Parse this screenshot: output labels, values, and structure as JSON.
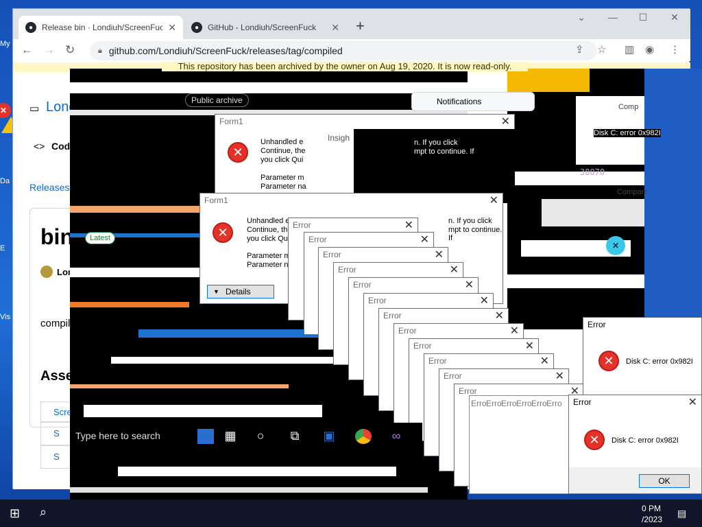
{
  "browser": {
    "tabs": [
      {
        "label": "Release bin · Londiuh/ScreenFuck",
        "active": true
      },
      {
        "label": "GitHub - Londiuh/ScreenFuck",
        "active": false
      }
    ],
    "new_tab_label": "+",
    "url": "github.com/Londiuh/ScreenFuck/releases/tag/compiled",
    "archive_banner": "This repository has been archived by the owner on Aug 19, 2020. It is now read-only."
  },
  "github": {
    "repo_owner": "Lond",
    "code_tab": "Code",
    "releases_link": "Releases",
    "release_title": "bin",
    "author": "Lond",
    "release_body": "compiled exe",
    "assets_heading": "Assets",
    "assets": [
      "ScreenFuck",
      "S",
      "S"
    ],
    "notifications": "Notifications",
    "public_archive": "Public archive",
    "latest_badge": "Latest"
  },
  "form_dialogs": [
    {
      "title": "Form1",
      "message": "Unhandled exception has occurred in your application. If you click Continue, the application will ignore this error and attempt to continue. If you click Quit, the application will close immediately.",
      "line1": "Unhandled e",
      "line1b": "n. If you click",
      "line2": "Continue, the",
      "line2b": "mpt to continue. If",
      "line3": "you click Qui",
      "detail1": "Parameter m",
      "detail2": "Parameter na"
    },
    {
      "title": "Form1",
      "line1": "Unhandled e",
      "line1b": "n. If you click",
      "line2": "Continue, the",
      "line2b": "mpt to continue. If",
      "line3": "you click Qui",
      "detail1": "Parameter m",
      "detail2": "Parameter na",
      "details_button": "Details"
    }
  ],
  "error_dialogs": {
    "title": "Error",
    "message": "Disk C: error 0x982I",
    "ok_label": "OK",
    "tab_fragments": [
      "Erro",
      "Erro",
      "Erro",
      "Erro",
      "Erro",
      "Erro",
      "Erro"
    ],
    "compare_fragment": "Compare",
    "comp_fragment": "Comp",
    "disk_fragment": "Disk C: error 0x982I",
    "hex_fragment": "38070",
    "insights_fragment": "Insigh"
  },
  "taskbar": {
    "search_placeholder": "Type here to search",
    "clock_time": "0 PM",
    "clock_date": "/2023"
  },
  "desktop": {
    "icon_labels": [
      "My",
      "Da",
      "E",
      "Vis"
    ]
  },
  "colors": {
    "error_red": "#e4322b",
    "github_link": "#0969da",
    "banner_bg": "#fff8c5",
    "dialog_border": "#0078d7"
  }
}
